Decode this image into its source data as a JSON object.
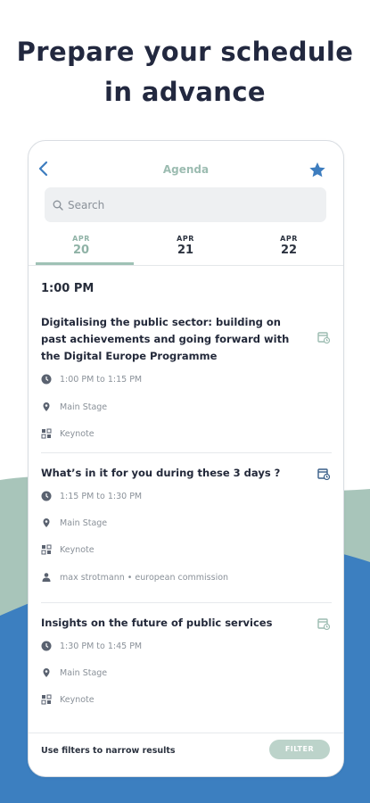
{
  "headline": {
    "line1": "Prepare your schedule",
    "line2": "in advance"
  },
  "colors": {
    "accent": "#9cbcb1",
    "wave_green": "#a8c5ba",
    "wave_blue": "#3c7fc0",
    "star": "#3d7dbf"
  },
  "header": {
    "title": "Agenda",
    "back_icon": "chevron-left-icon",
    "favorite_icon": "star-icon"
  },
  "search": {
    "placeholder": "Search"
  },
  "date_tabs": [
    {
      "month": "APR",
      "day": "20",
      "active": true
    },
    {
      "month": "APR",
      "day": "21",
      "active": false
    },
    {
      "month": "APR",
      "day": "22",
      "active": false
    }
  ],
  "time_heading": "1:00 PM",
  "sessions": [
    {
      "title": "Digitalising the public sector: building on past achievements and going forward with the Digital Europe Programme",
      "time": "1:00 PM to 1:15 PM",
      "location": "Main Stage",
      "type": "Keynote"
    },
    {
      "title": "What’s in it for you during these 3 days ?",
      "time": "1:15 PM to 1:30 PM",
      "location": "Main Stage",
      "type": "Keynote",
      "speaker": "max strotmann • european commission"
    },
    {
      "title": "Insights on the future of public services",
      "time": "1:30 PM to 1:45 PM",
      "location": "Main Stage",
      "type": "Keynote"
    }
  ],
  "footer": {
    "hint": "Use filters to narrow results",
    "filter_label": "FILTER"
  }
}
